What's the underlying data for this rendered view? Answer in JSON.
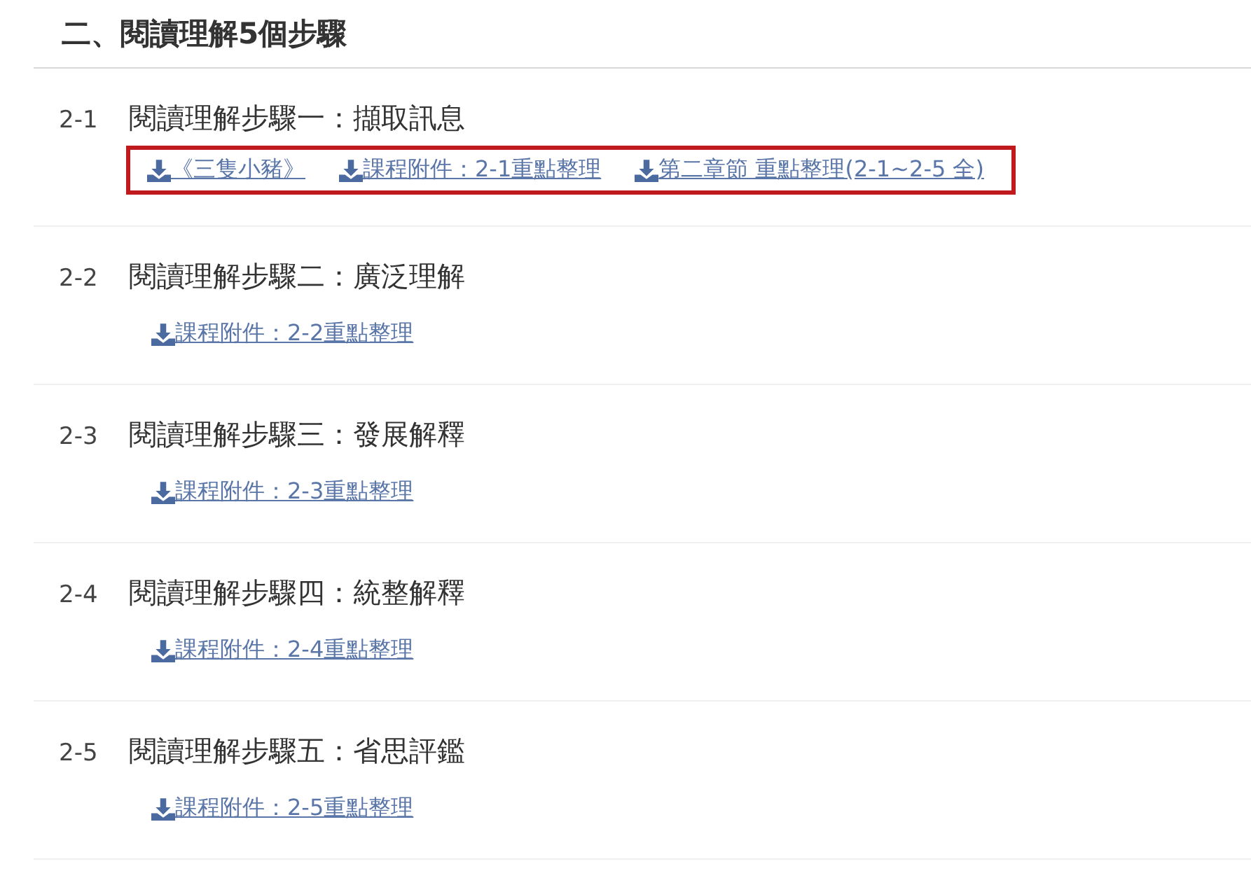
{
  "heading": "二、閱讀理解5個步驟",
  "sections": [
    {
      "number": "2-1",
      "title": "閱讀理解步驟一：擷取訊息",
      "highlighted": true,
      "links": [
        "《三隻小豬》",
        "課程附件：2-1重點整理",
        "第二章節 重點整理(2-1~2-5 全)"
      ]
    },
    {
      "number": "2-2",
      "title": "閱讀理解步驟二：廣泛理解",
      "highlighted": false,
      "links": [
        "課程附件：2-2重點整理"
      ]
    },
    {
      "number": "2-3",
      "title": "閱讀理解步驟三：發展解釋",
      "highlighted": false,
      "links": [
        "課程附件：2-3重點整理"
      ]
    },
    {
      "number": "2-4",
      "title": "閱讀理解步驟四：統整解釋",
      "highlighted": false,
      "links": [
        "課程附件：2-4重點整理"
      ]
    },
    {
      "number": "2-5",
      "title": "閱讀理解步驟五：省思評鑑",
      "highlighted": false,
      "links": [
        "課程附件：2-5重點整理"
      ]
    }
  ]
}
